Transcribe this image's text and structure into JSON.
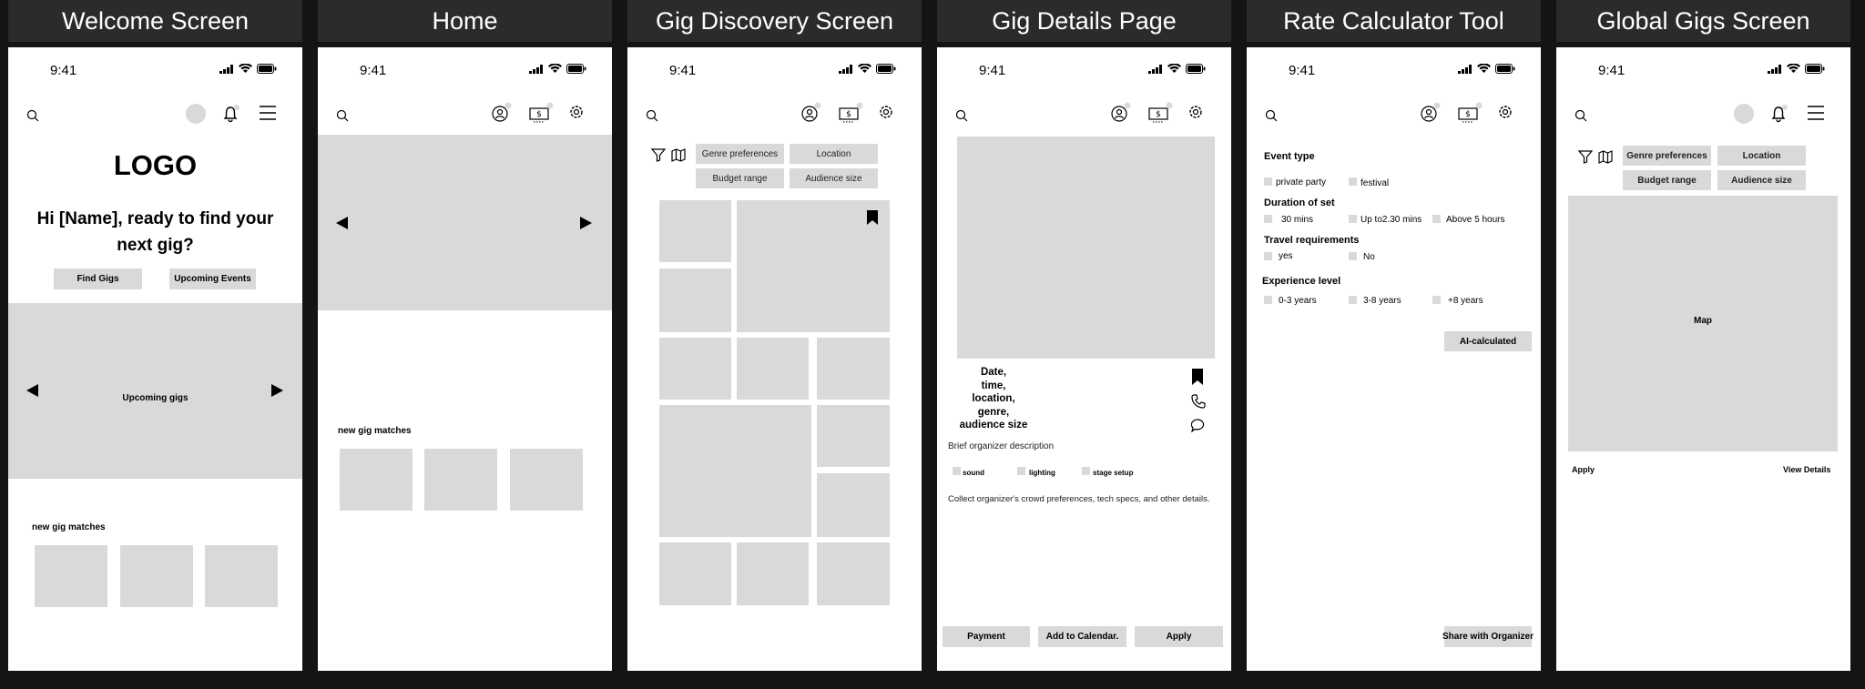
{
  "boards": [
    {
      "title": "Welcome Screen",
      "time": "9:41"
    },
    {
      "title": "Home",
      "time": "9:41"
    },
    {
      "title": "Gig Discovery Screen",
      "time": "9:41"
    },
    {
      "title": "Gig Details Page",
      "time": "9:41"
    },
    {
      "title": "Rate Calculator Tool",
      "time": "9:41"
    },
    {
      "title": "Global Gigs Screen",
      "time": "9:41"
    }
  ],
  "welcome": {
    "logo": "LOGO",
    "greeting": "Hi [Name], ready to find your next gig?",
    "find_gigs": "Find Gigs",
    "upcoming_events": "Upcoming Events",
    "carousel_label": "Upcoming gigs",
    "matches_label": "new gig matches"
  },
  "home": {
    "matches_label": "new gig matches"
  },
  "discovery": {
    "filters": [
      "Genre preferences",
      "Location",
      "Budget range",
      "Audience size"
    ]
  },
  "details": {
    "info": "Date,\ntime,\nlocation,\ngenre,\naudience size",
    "description": "Brief organizer description",
    "options": [
      "sound",
      "lighting",
      "stage setup"
    ],
    "note": "Collect organizer's crowd preferences, tech specs, and other details.",
    "buttons": [
      "Payment",
      "Add to Calendar.",
      "Apply"
    ]
  },
  "calculator": {
    "event_type": {
      "heading": "Event type",
      "options": [
        "private party",
        "festival"
      ]
    },
    "duration": {
      "heading": "Duration of set",
      "options": [
        "30 mins",
        "Up to2.30 mins",
        "Above 5 hours"
      ]
    },
    "travel": {
      "heading": "Travel requirements",
      "options": [
        "yes",
        "No"
      ]
    },
    "experience": {
      "heading": "Experience level",
      "options": [
        "0-3 years",
        "3-8 years",
        "+8 years"
      ]
    },
    "ai_button": "AI-calculated",
    "share_button": "Share with Organizer"
  },
  "global": {
    "filters": [
      "Genre preferences",
      "Location",
      "Budget range",
      "Audience size"
    ],
    "map_label": "Map",
    "apply": "Apply",
    "view_details": "View Details"
  },
  "icons": [
    "search-icon",
    "bell-icon",
    "menu-icon",
    "profile-icon",
    "wallet-icon",
    "gear-icon",
    "filter-icon",
    "map-icon",
    "bookmark-icon",
    "phone-icon",
    "chat-icon"
  ]
}
